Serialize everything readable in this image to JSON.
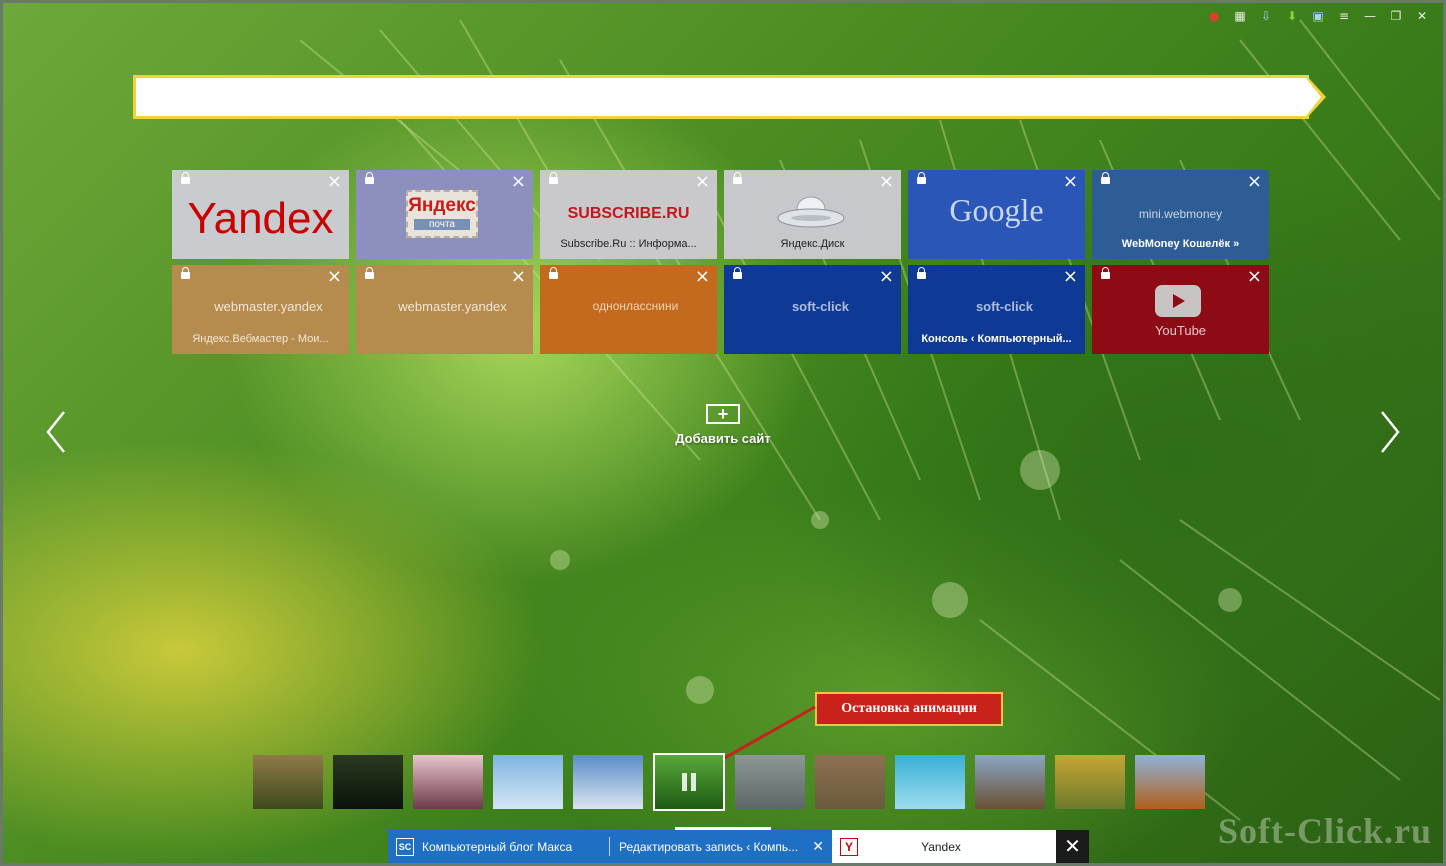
{
  "toolbar": {
    "icons": [
      "adblock-icon",
      "reader-icon",
      "download-manager-icon",
      "download-arrow-icon",
      "image-icon",
      "menu-icon",
      "minimize-icon",
      "restore-icon",
      "close-icon"
    ],
    "glyphs": [
      "●",
      "▦",
      "⇩",
      "⬇",
      "▣",
      "≡",
      "—",
      "❐",
      "✕"
    ]
  },
  "search": {
    "value": "",
    "placeholder": ""
  },
  "tiles": [
    {
      "title": "Yandex",
      "subtitle": "",
      "bg": "#c9cccf"
    },
    {
      "title": "Яндекс",
      "badge": "почта",
      "subtitle": "",
      "bg": "#8d8fbe"
    },
    {
      "title": "SUBSCRIBE.RU",
      "subtitle": "Subscribe.Ru :: Информа...",
      "bg": "#c9c9cc"
    },
    {
      "title": "",
      "subtitle": "Яндекс.Диск",
      "bg": "#c6c8cc"
    },
    {
      "title": "Google",
      "subtitle": "",
      "bg": "#2a56b7"
    },
    {
      "title": "mini.webmoney",
      "subtitle": "WebMoney Кошелёк »",
      "bg": "#2e5d95"
    },
    {
      "title": "webmaster.yandex",
      "subtitle": "Яндекс.Вебмастер - Мои...",
      "bg": "#b68b4e"
    },
    {
      "title": "webmaster.yandex",
      "subtitle": "",
      "bg": "#b68b4e"
    },
    {
      "title": "однонласснини",
      "subtitle": "",
      "bg": "#c36a1e"
    },
    {
      "title": "soft-click",
      "subtitle": "",
      "bg": "#0e3a95"
    },
    {
      "title": "soft-click",
      "subtitle": "Консоль ‹ Компьютерный...",
      "bg": "#0e3a95"
    },
    {
      "title": "YouTube",
      "subtitle": "",
      "bg": "#8c0b14"
    }
  ],
  "add_site": {
    "label": "Добавить сайт"
  },
  "callout": {
    "text": "Остановка анимации"
  },
  "thumbnails": [
    {
      "name": "autumn-forest",
      "c1": "#8f7a48",
      "c2": "#3d4a1e"
    },
    {
      "name": "dark-forest",
      "c1": "#2a3a20",
      "c2": "#0c120b"
    },
    {
      "name": "cherry-blossom",
      "c1": "#e8c4cc",
      "c2": "#6d3a48"
    },
    {
      "name": "blue-sky",
      "c1": "#7fb5e0",
      "c2": "#d4e6f4"
    },
    {
      "name": "clouds-hills",
      "c1": "#5b8dc9",
      "c2": "#d9e4ee"
    },
    {
      "name": "green-pine-active",
      "c1": "#58a93a",
      "c2": "#1f5a14"
    },
    {
      "name": "rain-glass",
      "c1": "#8c9796",
      "c2": "#5d6765"
    },
    {
      "name": "dry-grass",
      "c1": "#8e7152",
      "c2": "#6a5a3d"
    },
    {
      "name": "cyan-sea",
      "c1": "#37b0d6",
      "c2": "#9fdcee"
    },
    {
      "name": "mountain-lake",
      "c1": "#8aa6c4",
      "c2": "#6a5134"
    },
    {
      "name": "golden-field",
      "c1": "#c8a534",
      "c2": "#6b7b2c"
    },
    {
      "name": "autumn-mountain",
      "c1": "#8fb1d8",
      "c2": "#b0601a"
    }
  ],
  "taskbar": [
    {
      "label": "Компьютерный блог Макса",
      "icon": "soft-click-icon",
      "glyph": "SC"
    },
    {
      "label": "Редактировать запись ‹ Компь...",
      "icon": "",
      "glyph": "",
      "close": "✕"
    },
    {
      "label": "Yandex",
      "icon": "yandex-icon",
      "glyph": "Y"
    },
    {
      "label": "✕"
    }
  ],
  "watermark": "Soft-Click.ru"
}
